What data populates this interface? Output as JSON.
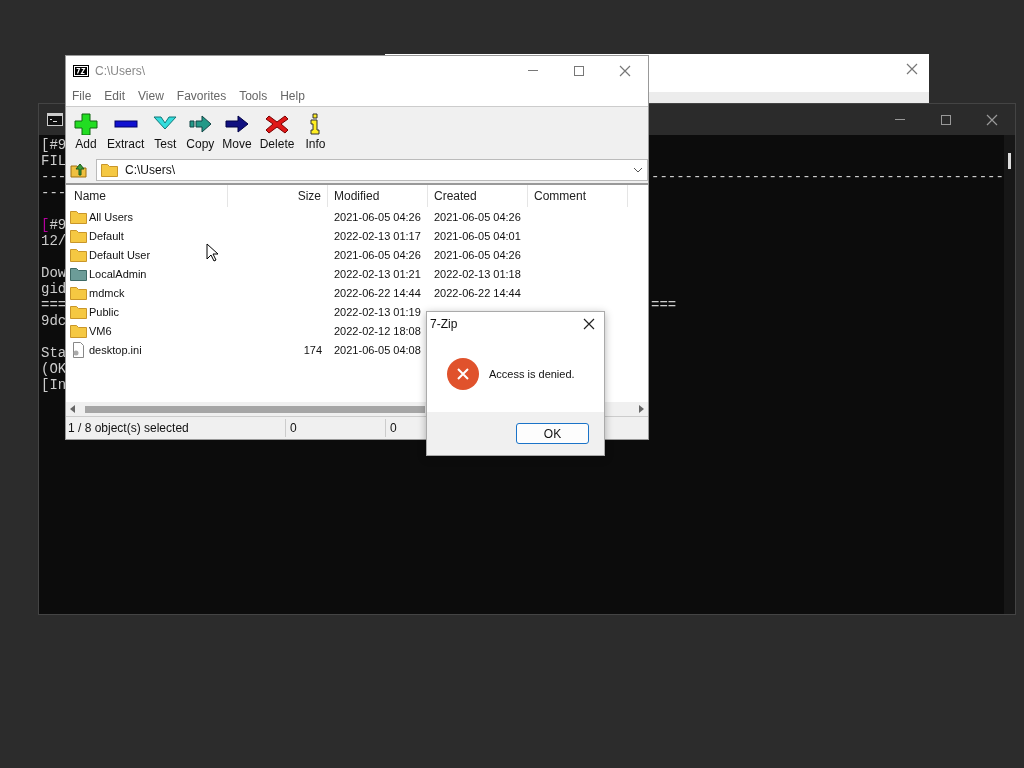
{
  "console": {
    "blocks": [
      [
        {
          "text": "[#9"
        },
        {
          "text": "FIL"
        },
        {
          "text": "---",
          "tail": "------------------------------------------"
        },
        {
          "text": "---"
        }
      ],
      [
        {
          "prefix": "[",
          "text": "#9"
        },
        {
          "text": "12/"
        }
      ],
      [
        {
          "text": "Dow"
        },
        {
          "text": "gid"
        },
        {
          "text": "===",
          "tail": "==="
        },
        {
          "text": "9dc"
        }
      ],
      [
        {
          "text": "Sta"
        },
        {
          "text": "(OK"
        },
        {
          "text": "[In"
        }
      ]
    ]
  },
  "archiver": {
    "title": "C:\\Users\\",
    "menu": [
      "File",
      "Edit",
      "View",
      "Favorites",
      "Tools",
      "Help"
    ],
    "toolbar": [
      {
        "label": "Add",
        "kind": "add"
      },
      {
        "label": "Extract",
        "kind": "extract"
      },
      {
        "label": "Test",
        "kind": "test"
      },
      {
        "label": "Copy",
        "kind": "copy"
      },
      {
        "label": "Move",
        "kind": "move"
      },
      {
        "label": "Delete",
        "kind": "delete"
      },
      {
        "label": "Info",
        "kind": "info"
      }
    ],
    "path": "C:\\Users\\",
    "columns": [
      "Name",
      "Size",
      "Modified",
      "Created",
      "Comment"
    ],
    "rows": [
      {
        "kind": "folder",
        "name": "All Users",
        "modified": "2021-06-05 04:26",
        "created": "2021-06-05 04:26"
      },
      {
        "kind": "folder",
        "name": "Default",
        "modified": "2022-02-13 01:17",
        "created": "2021-06-05 04:01"
      },
      {
        "kind": "folder",
        "name": "Default User",
        "modified": "2021-06-05 04:26",
        "created": "2021-06-05 04:26"
      },
      {
        "kind": "special-folder",
        "name": "LocalAdmin",
        "modified": "2022-02-13 01:21",
        "created": "2022-02-13 01:18"
      },
      {
        "kind": "folder",
        "name": "mdmck",
        "modified": "2022-06-22 14:44",
        "created": "2022-06-22 14:44"
      },
      {
        "kind": "folder",
        "name": "Public",
        "modified": "2022-02-13 01:19"
      },
      {
        "kind": "folder",
        "name": "VM6",
        "modified": "2022-02-12 18:08"
      },
      {
        "kind": "file",
        "name": "desktop.ini",
        "size": "174",
        "modified": "2021-06-05 04:08"
      }
    ],
    "status": [
      "1 / 8 object(s) selected",
      "0",
      "0"
    ]
  },
  "dialog": {
    "title": "7-Zip",
    "message": "Access is denied.",
    "button": "OK"
  }
}
